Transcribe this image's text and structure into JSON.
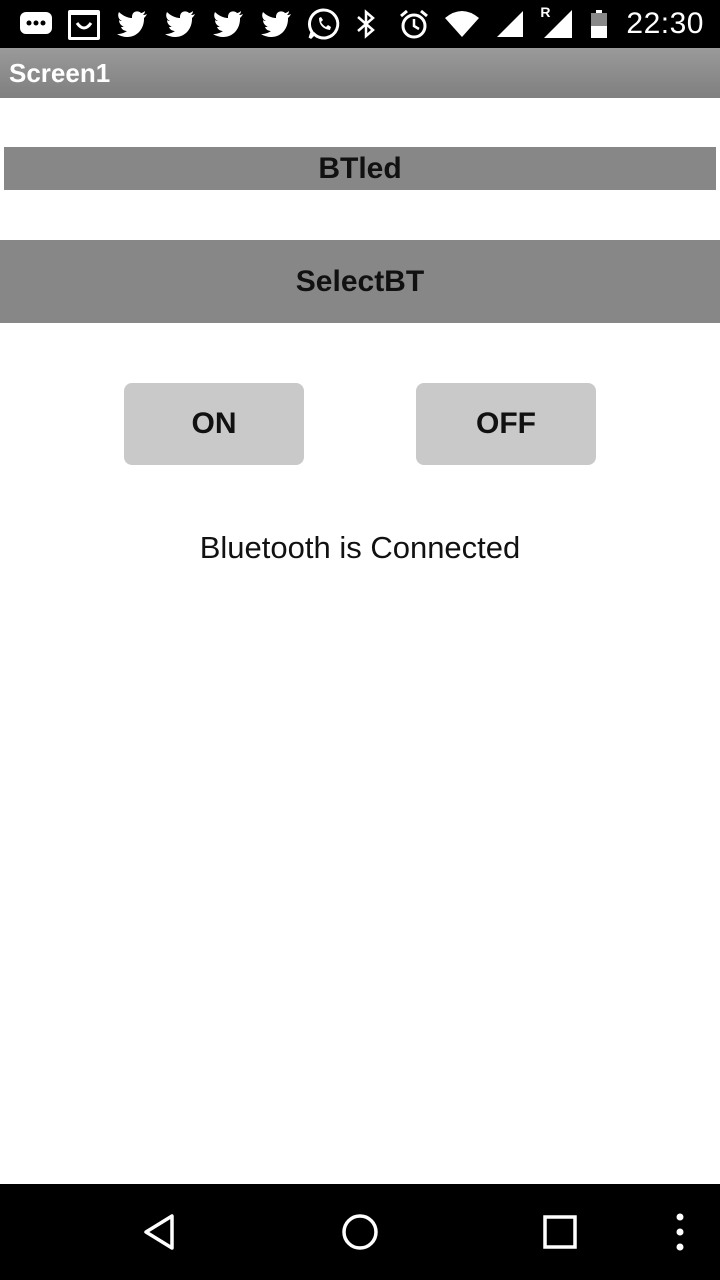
{
  "status_bar": {
    "time": "22:30",
    "left_icons": [
      "chat-bubble-icon",
      "shopping-bag-icon",
      "twitter-icon",
      "twitter-icon",
      "twitter-icon",
      "twitter-icon",
      "whatsapp-icon"
    ],
    "right_icons": [
      "bluetooth-icon",
      "alarm-icon",
      "wifi-icon",
      "cell-signal-icon",
      "roaming-signal-icon",
      "battery-icon"
    ],
    "roaming_indicator": "R"
  },
  "title_bar": {
    "title": "Screen1",
    "color": "#888888"
  },
  "main": {
    "app_label": "BTled",
    "select_button_label": "SelectBT",
    "on_button_label": "ON",
    "off_button_label": "OFF",
    "connection_status": "Bluetooth is Connected"
  },
  "nav_bar": {
    "icons": [
      "back-icon",
      "home-icon",
      "recents-icon",
      "overflow-menu-icon"
    ]
  },
  "colors": {
    "label_bg": "#878787",
    "button_bg": "#c9c9c9",
    "text": "#111111"
  }
}
